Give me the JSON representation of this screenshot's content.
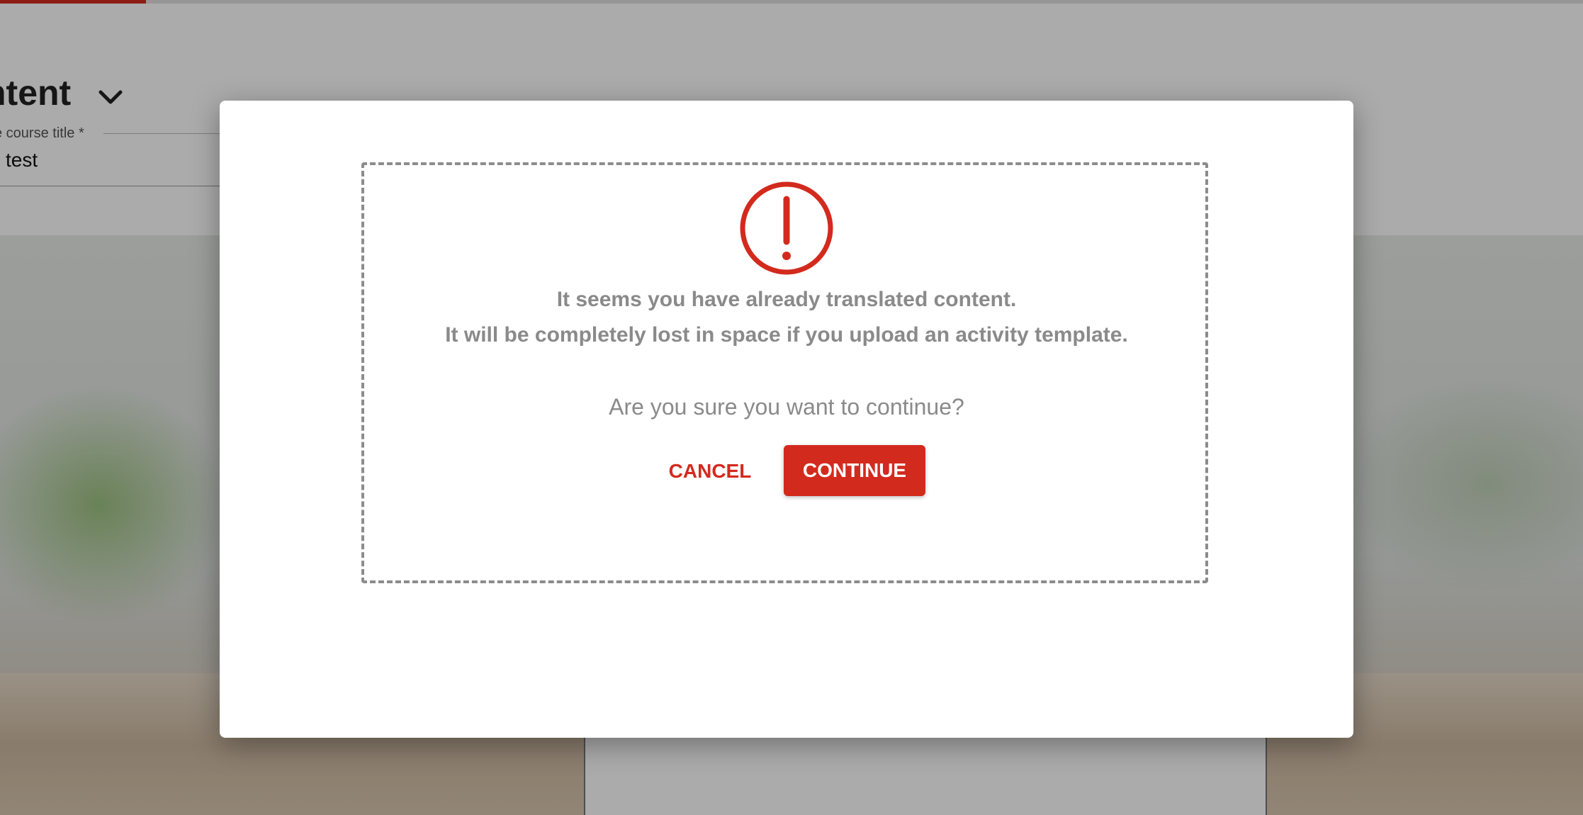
{
  "background": {
    "heading": "ntent",
    "field_label": "e course title *",
    "field_value": "l test"
  },
  "dialog": {
    "message_line_1": "It seems you have already translated content.",
    "message_line_2": "It will be completely lost in space if you upload an activity template.",
    "question": "Are you sure you want to continue?",
    "cancel_label": "CANCEL",
    "continue_label": "CONTINUE",
    "icon": "alert-circle-icon"
  },
  "colors": {
    "accent": "#d32a1e",
    "text_muted": "#8a8a8a",
    "dashed_border": "#8c8c8c"
  }
}
